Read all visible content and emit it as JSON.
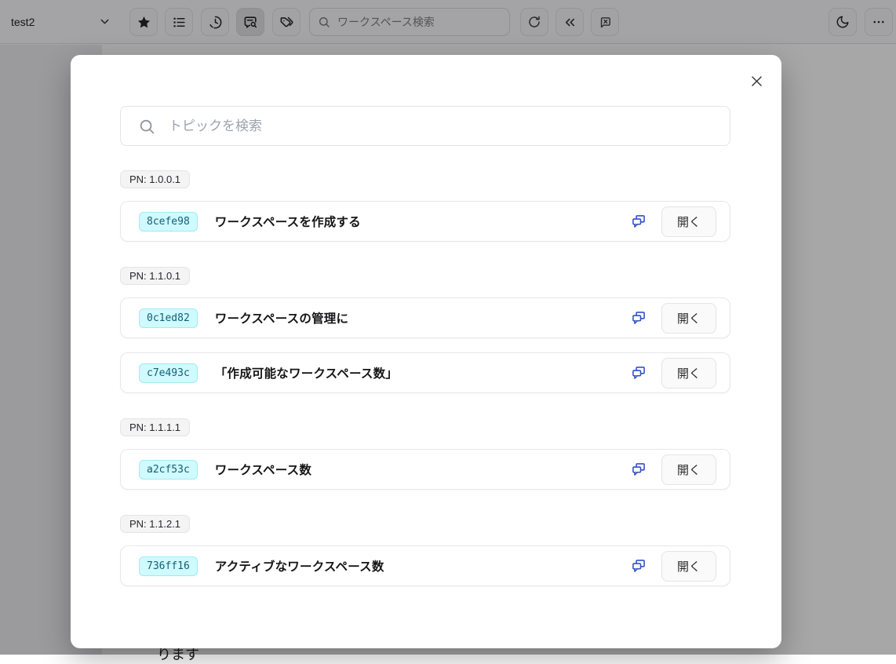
{
  "toolbar": {
    "workspace_label": "test2",
    "search_placeholder": "ワークスペース検索",
    "left_icons": [
      "chevron-down",
      "star",
      "list",
      "history-clock",
      "chat-search",
      "tags"
    ],
    "right_icons": [
      "refresh",
      "chevrons-left",
      "message-box-x",
      "moon",
      "ellipsis"
    ],
    "active_icon": "chat-search"
  },
  "background_page": {
    "partial_text": "ります"
  },
  "modal": {
    "close_icon": "close-x",
    "search_placeholder": "トピックを検索",
    "open_label": "開く",
    "row_icon": "chat-bubbles",
    "groups": [
      {
        "pn": "PN: 1.0.0.1",
        "items": [
          {
            "code": "8cefe98",
            "title": "ワークスペースを作成する"
          }
        ]
      },
      {
        "pn": "PN: 1.1.0.1",
        "items": [
          {
            "code": "0c1ed82",
            "title": "ワークスペースの管理に"
          },
          {
            "code": "c7e493c",
            "title": "「作成可能なワークスペース数」"
          }
        ]
      },
      {
        "pn": "PN: 1.1.1.1",
        "items": [
          {
            "code": "a2cf53c",
            "title": "ワークスペース数"
          }
        ]
      },
      {
        "pn": "PN: 1.1.2.1",
        "items": [
          {
            "code": "736ff16",
            "title": "アクティブなワークスペース数"
          }
        ]
      }
    ]
  },
  "colors": {
    "accent_blue": "#3451c6",
    "code_badge_bg": "#cffafe",
    "code_badge_border": "#a3e9f5",
    "code_badge_text": "#155e75",
    "pn_badge_bg": "#f4f4f5",
    "border_light": "#e4e4e7",
    "placeholder": "#9ca3af",
    "overlay": "rgba(12,12,14,0.36)"
  }
}
